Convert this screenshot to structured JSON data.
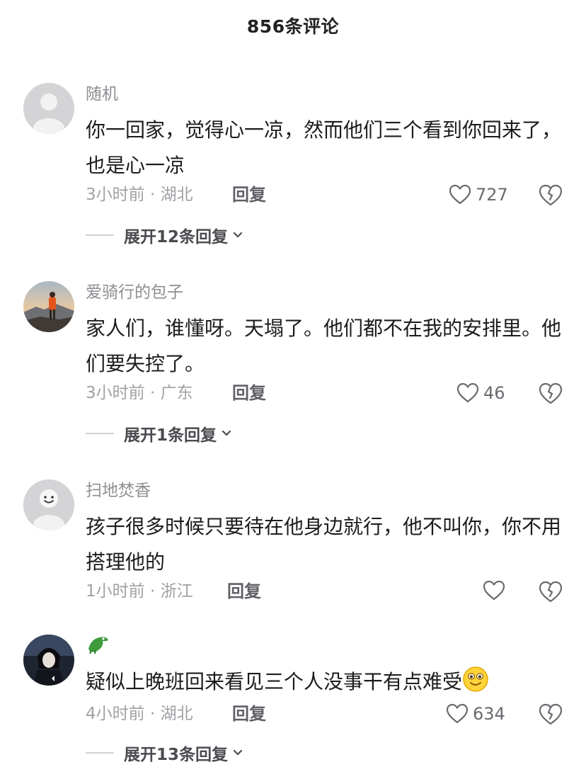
{
  "header": {
    "title": "856条评论"
  },
  "comments": [
    {
      "username": "随机",
      "text": "你一回家，觉得心一凉，然而他们三个看到你回来了，也是心一凉",
      "meta": "3小时前 · 湖北",
      "reply_label": "回复",
      "likes": "727",
      "expand": "展开12条回复"
    },
    {
      "username": "爱骑行的包子",
      "text": "家人们，谁懂呀。天塌了。他们都不在我的安排里。他们要失控了。",
      "meta": "3小时前 · 广东",
      "reply_label": "回复",
      "likes": "46",
      "expand": "展开1条回复"
    },
    {
      "username": "扫地焚香",
      "text": "孩子很多时候只要待在他身边就行，他不叫你，你不用搭理他的",
      "meta": "1小时前 · 浙江",
      "reply_label": "回复",
      "likes": ""
    },
    {
      "username_icon": "crocodile-emoji",
      "text": "疑似上晚班回来看见三个人没事干有点难受",
      "text_emoji": "smiling-face-emoji",
      "meta": "4小时前 · 湖北",
      "reply_label": "回复",
      "likes": "634",
      "expand": "展开13条回复"
    }
  ],
  "colors": {
    "text": "#1c1c1c",
    "muted": "#a1a1a6",
    "username": "#8e8e93"
  }
}
